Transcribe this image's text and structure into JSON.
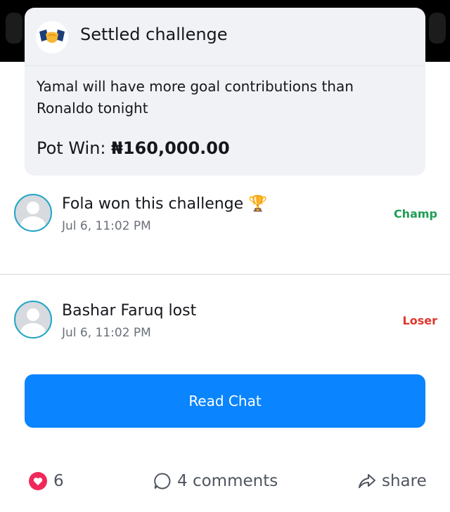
{
  "card": {
    "title": "Settled challenge",
    "icon": "handshake-icon",
    "description": "Yamal will have more goal contributions than Ronaldo tonight",
    "pot_label": "Pot Win:",
    "pot_value": "₦160,000.00"
  },
  "participants": [
    {
      "name": "Fola won this challenge",
      "emoji": "🏆",
      "time": "Jul 6, 11:02 PM",
      "status": "Champ",
      "status_color": "#1f9d55"
    },
    {
      "name": "Bashar Faruq lost",
      "emoji": "",
      "time": "Jul 6, 11:02 PM",
      "status": "Loser",
      "status_color": "#e0362b"
    }
  ],
  "read_chat_label": "Read Chat",
  "actions": {
    "likes_count": "6",
    "comments_label": "4 comments",
    "share_label": "share"
  },
  "colors": {
    "accent": "#0a84ff",
    "heart": "#f0285a",
    "avatar_ring": "#1fa4c7"
  }
}
